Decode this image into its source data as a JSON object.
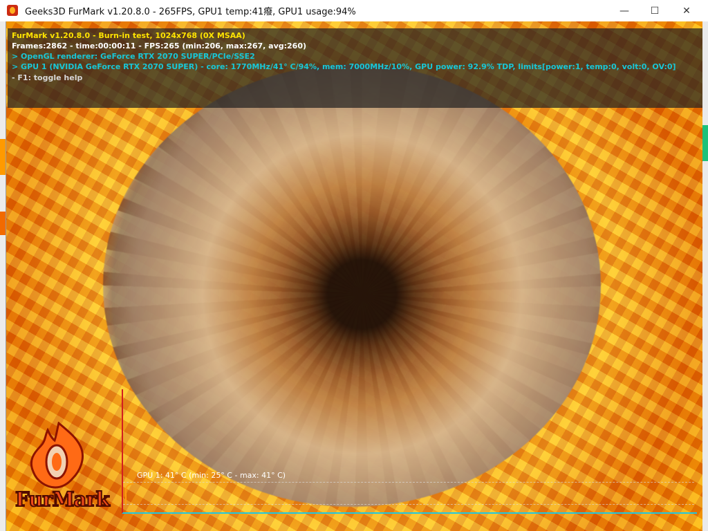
{
  "window": {
    "title": "Geeks3D FurMark v1.20.8.0 - 265FPS, GPU1 temp:41癈, GPU1 usage:94%",
    "controls": {
      "minimize": "—",
      "maximize": "☐",
      "close": "✕"
    }
  },
  "hud": {
    "line1": "FurMark v1.20.8.0 - Burn-in test, 1024x768 (0X MSAA)",
    "line2": "Frames:2862 - time:00:00:11 - FPS:265 (min:206, max:267, avg:260)",
    "line3": "> OpenGL renderer: GeForce RTX 2070 SUPER/PCIe/SSE2",
    "line4": "> GPU 1 (NVIDIA GeForce RTX 2070 SUPER) - core: 1770MHz/41° C/94%, mem: 7000MHz/10%, GPU power: 92.9% TDP, limits[power:1, temp:0, volt:0, OV:0]",
    "line5": "- F1: toggle help"
  },
  "graph": {
    "label": "GPU 1: 41° C (min: 25° C - max: 41° C)"
  },
  "branding": {
    "logo_text": "FurMark"
  },
  "colors": {
    "title_text": "#111111",
    "hud_yellow": "#ffe400",
    "hud_cyan": "#18c7d7",
    "graph_red": "#d21f1f",
    "graph_cyan": "#1ec8e2",
    "trace_orange": "#ff9b0f"
  }
}
